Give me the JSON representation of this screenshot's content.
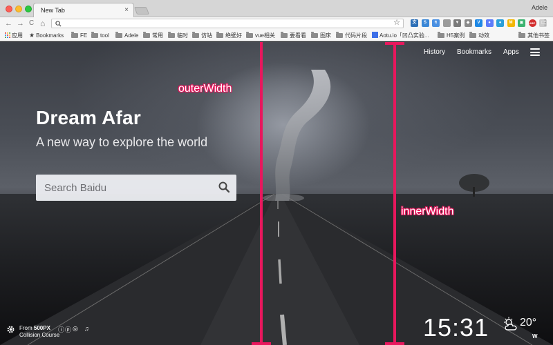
{
  "window": {
    "tab_title": "New Tab",
    "tab_close": "×",
    "profile_name": "Adele"
  },
  "toolbar": {
    "back_glyph": "←",
    "forward_glyph": "→",
    "reload_glyph": "C",
    "home_glyph": "⌂",
    "url_value": "",
    "star_glyph": "☆",
    "menu_glyph": "⋮",
    "extensions": [
      {
        "name": "ext-1",
        "color": "#2c6fb7",
        "text": "文"
      },
      {
        "name": "ext-2",
        "color": "#3b87d6",
        "text": "S"
      },
      {
        "name": "ext-3",
        "color": "#4a90e2",
        "text": "↯"
      },
      {
        "name": "ext-4",
        "color": "#9b9b9b",
        "text": ""
      },
      {
        "name": "ext-5",
        "color": "#7a7a7a",
        "text": "▼"
      },
      {
        "name": "ext-6",
        "color": "#8a8a8a",
        "text": "◆"
      },
      {
        "name": "ext-7",
        "color": "#1e88e5",
        "text": "V"
      },
      {
        "name": "ext-8",
        "color": "#5c7cfa",
        "text": "●"
      },
      {
        "name": "ext-9",
        "color": "#2b9fd9",
        "text": "●"
      },
      {
        "name": "ext-10",
        "color": "#f2b705",
        "text": "M"
      },
      {
        "name": "ext-11",
        "color": "#3cb371",
        "text": "▣"
      },
      {
        "name": "ext-12",
        "color": "#d32f2f",
        "text": "ABP"
      },
      {
        "name": "ext-13",
        "color": "#cccccc",
        "text": "▢"
      }
    ]
  },
  "bookmarks": {
    "apps_label": "应用",
    "items": [
      "Bookmarks",
      "FE",
      "tool",
      "Adele",
      "常用",
      "临时",
      "仿站",
      "绝壁好",
      "vue相关",
      "要看看",
      "图床",
      "代码片段",
      "Aotu.io「凹凸实验...",
      "H5案例",
      "动效"
    ],
    "other_label": "其他书签"
  },
  "page": {
    "nav": {
      "history": "History",
      "bookmarks": "Bookmarks",
      "apps": "Apps"
    },
    "title": "Dream Afar",
    "subtitle": "A new way to explore the world",
    "search_placeholder": "Search Baidu",
    "footer": {
      "credit_from": "From",
      "credit_source": "500PX",
      "credit_photo": "Collision Course",
      "clock": "15:31",
      "temperature": "20°",
      "wind_direction": "W"
    }
  },
  "annotations": {
    "outer_label": "outerWidth",
    "inner_label": "innerWidth",
    "color": "#e8175d"
  }
}
